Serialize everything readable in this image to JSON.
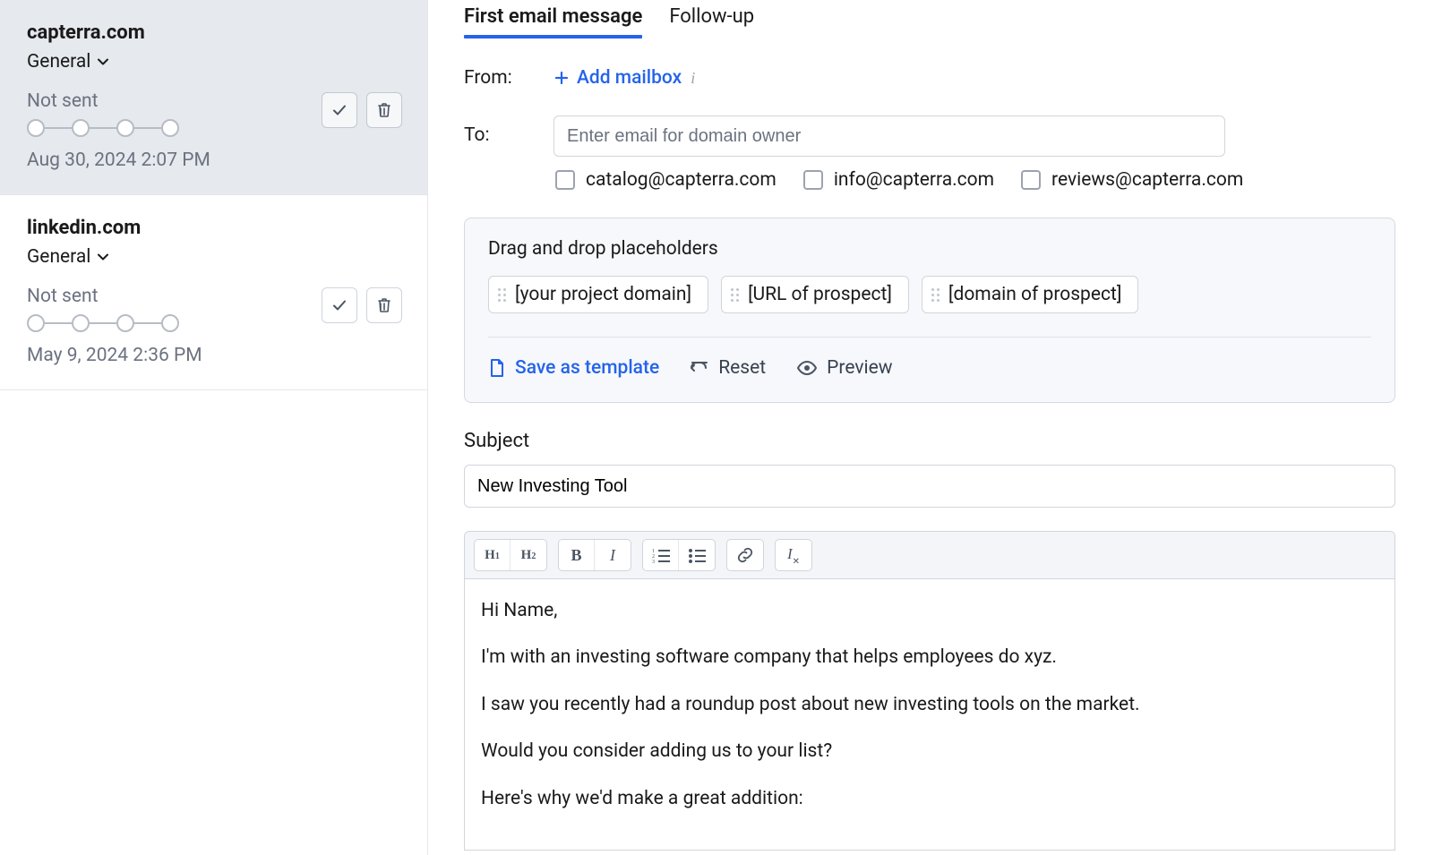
{
  "sidebar": {
    "items": [
      {
        "domain": "capterra.com",
        "category": "General",
        "status": "Not sent",
        "date": "Aug 30, 2024 2:07 PM",
        "selected": true
      },
      {
        "domain": "linkedin.com",
        "category": "General",
        "status": "Not sent",
        "date": "May 9, 2024 2:36 PM",
        "selected": false
      }
    ]
  },
  "tabs": {
    "first": "First email message",
    "followup": "Follow-up"
  },
  "from": {
    "label": "From:",
    "add_mailbox": "Add mailbox"
  },
  "to": {
    "label": "To:",
    "placeholder": "Enter email for domain owner",
    "options": [
      "catalog@capterra.com",
      "info@capterra.com",
      "reviews@capterra.com"
    ]
  },
  "placeholders": {
    "title": "Drag and drop placeholders",
    "chips": [
      "[your project domain]",
      "[URL of prospect]",
      "[domain of prospect]"
    ],
    "actions": {
      "save": "Save as template",
      "reset": "Reset",
      "preview": "Preview"
    }
  },
  "subject": {
    "label": "Subject",
    "value": "New Investing Tool"
  },
  "editor": {
    "paragraphs": [
      "Hi Name,",
      "I'm with an investing software company that helps employees do xyz.",
      "I saw you recently had a roundup post about new investing tools on the market.",
      "Would you consider adding us to your list?",
      "Here's why we'd make a great addition:"
    ]
  }
}
